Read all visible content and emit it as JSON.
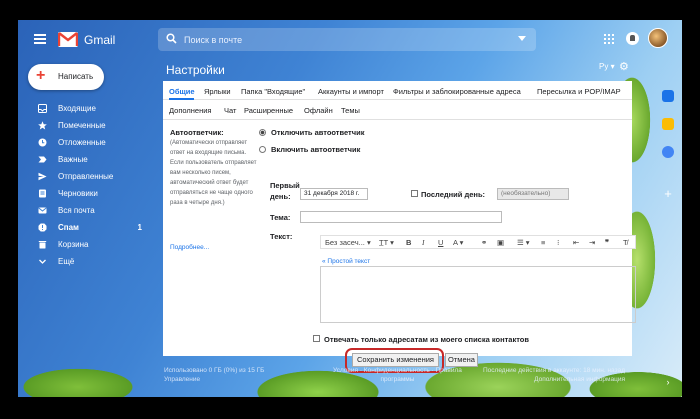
{
  "app": {
    "name": "Gmail"
  },
  "search": {
    "placeholder": "Поиск в почте"
  },
  "compose": {
    "label": "Написать"
  },
  "sidebar": {
    "items": [
      {
        "label": "Входящие",
        "count": ""
      },
      {
        "label": "Помеченные",
        "count": ""
      },
      {
        "label": "Отложенные",
        "count": ""
      },
      {
        "label": "Важные",
        "count": ""
      },
      {
        "label": "Отправленные",
        "count": ""
      },
      {
        "label": "Черновики",
        "count": ""
      },
      {
        "label": "Вся почта",
        "count": ""
      },
      {
        "label": "Спам",
        "count": "1"
      },
      {
        "label": "Корзина",
        "count": ""
      },
      {
        "label": "Ещё",
        "count": ""
      }
    ]
  },
  "page": {
    "title": "Настройки",
    "lang": "Ру"
  },
  "tabs_row1": [
    "Общие",
    "Ярлыки",
    "Папка \"Входящие\"",
    "Аккаунты и импорт",
    "Фильтры и заблокированные адреса",
    "Пересылка и POP/IMAP"
  ],
  "tabs_row2": [
    "Дополнения",
    "Чат",
    "Расширенные",
    "Офлайн",
    "Темы"
  ],
  "autoreply": {
    "label": "Автоответчик:",
    "description": "(Автоматически отправляет ответ на входящие письма. Если пользователь отправляет вам несколько писем, автоматический ответ будет отправляться не чаще одного раза в четыре дня.)",
    "more_link": "Подробнее...",
    "option_off": "Отключить автоответчик",
    "option_on": "Включить автоответчик",
    "first_day_label_1": "Первый",
    "first_day_label_2": "день:",
    "first_day_value": "31 декабря 2018 г.",
    "last_day_label": "Последний день:",
    "last_day_value": "(необязательно)",
    "subject_label": "Тема:",
    "text_label": "Текст:",
    "font_select": "Без засеч...",
    "plain_text_link": "« Простой текст",
    "contacts_only_label": "Отвечать только адресатам из моего списка контактов"
  },
  "buttons": {
    "save": "Сохранить изменения",
    "cancel": "Отмена"
  },
  "footer": {
    "left": [
      "Использовано 0 ГБ (0%) из 15 ГБ",
      "Управление"
    ],
    "center": [
      "Условия · Конфиденциальность · Правила",
      "программы"
    ],
    "right": [
      "Последние действия в аккаунте: 18 мин. назад",
      "Дополнительная информация"
    ]
  },
  "colors": {
    "accent": "#1a73e8",
    "highlight_ring": "#c62828"
  }
}
